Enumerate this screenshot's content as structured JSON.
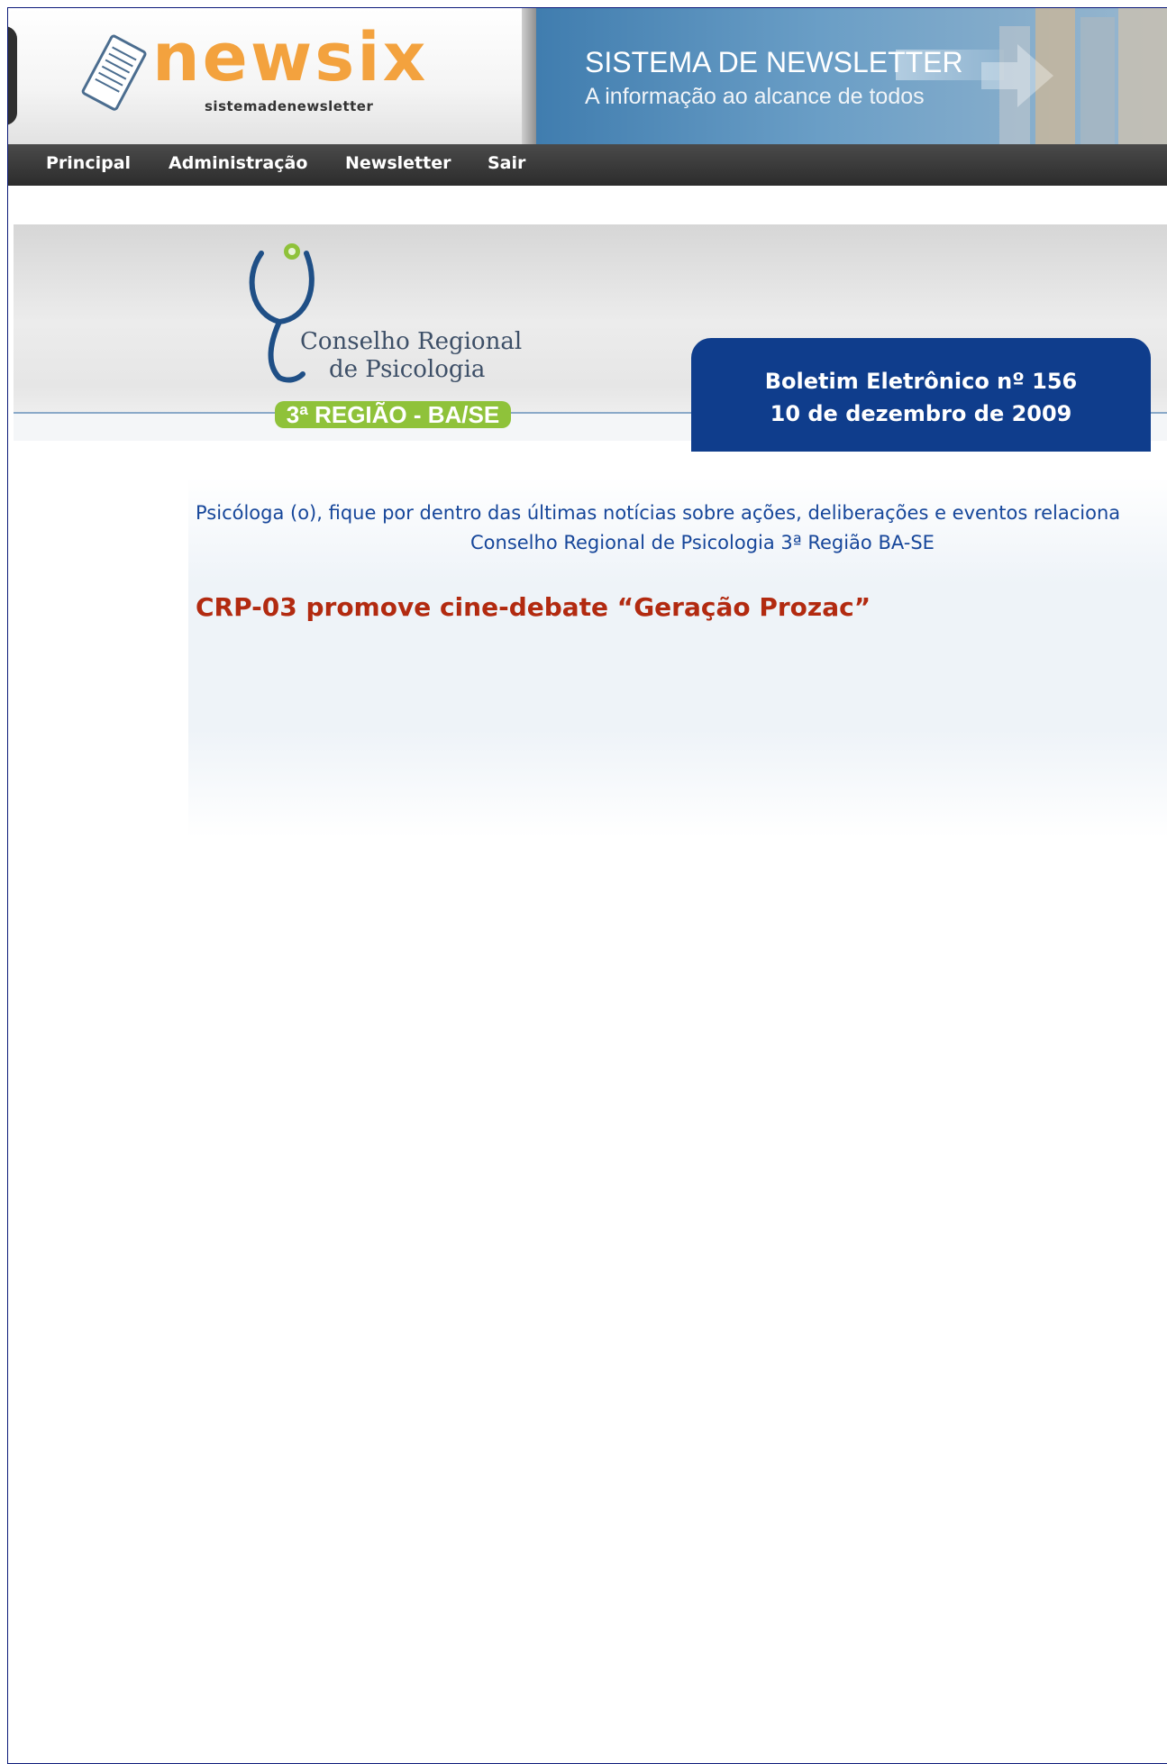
{
  "banner": {
    "brand": "newsix",
    "brand_tagline": "sistemadenewsletter",
    "system_title": "SISTEMA DE NEWSLETTER",
    "system_subtitle": "A informação ao alcance de todos",
    "brand_color": "#f3a23e"
  },
  "nav": {
    "items": [
      {
        "label": "Principal"
      },
      {
        "label": "Administração"
      },
      {
        "label": "Newsletter"
      },
      {
        "label": "Sair"
      }
    ]
  },
  "newsletter": {
    "org_line1": "Conselho Regional",
    "org_line2": "de Psicologia",
    "org_region": "3ª REGIÃO - BA/SE",
    "bulletin_title": "Boletim Eletrônico nº 156",
    "bulletin_date": "10 de dezembro de 2009",
    "intro_line1": "Psicóloga (o), fique por dentro das últimas notícias sobre ações, deliberações e eventos relaciona",
    "intro_line2": "Conselho Regional de Psicologia 3ª Região BA-SE",
    "headline": "CRP-03 promove cine-debate “Geração Prozac”",
    "accent_blue": "#0f3d8c",
    "headline_color": "#b22a10"
  }
}
